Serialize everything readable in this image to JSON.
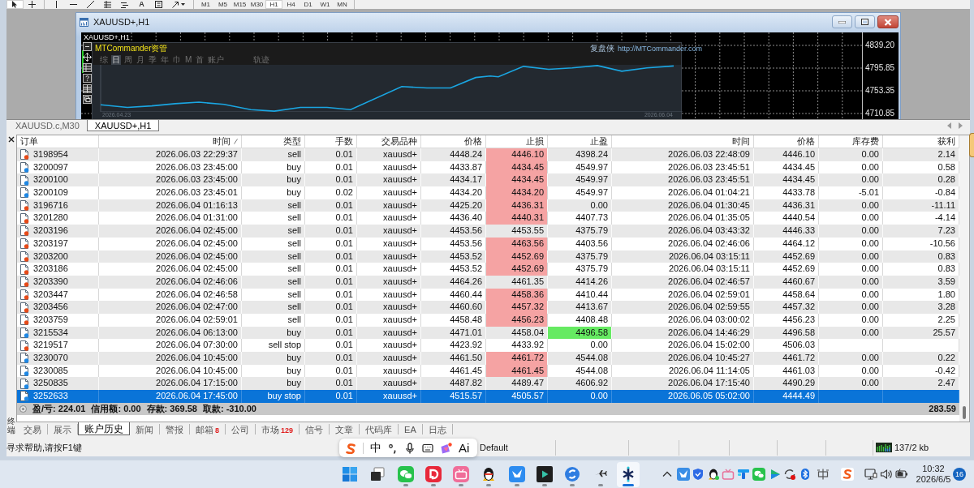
{
  "toolbar": {
    "tools": [
      {
        "kind": "cursor",
        "selected": true
      },
      {
        "kind": "crosshair",
        "selected": false
      },
      {
        "kind": "vertical-line",
        "selected": false
      },
      {
        "kind": "horizontal-line",
        "selected": false
      },
      {
        "kind": "trendline",
        "selected": false
      },
      {
        "kind": "fibonacci",
        "selected": false
      },
      {
        "kind": "channel",
        "selected": false
      },
      {
        "kind": "text",
        "label": "A",
        "selected": false
      },
      {
        "kind": "text-label",
        "selected": false
      },
      {
        "kind": "arrows",
        "selected": false
      }
    ],
    "timeframes": [
      {
        "label": "M1",
        "selected": false
      },
      {
        "label": "M5",
        "selected": false
      },
      {
        "label": "M15",
        "selected": false
      },
      {
        "label": "M30",
        "selected": false
      },
      {
        "label": "H1",
        "selected": true
      },
      {
        "label": "H4",
        "selected": false
      },
      {
        "label": "D1",
        "selected": false
      },
      {
        "label": "W1",
        "selected": false
      },
      {
        "label": "MN",
        "selected": false
      }
    ]
  },
  "chart_window": {
    "title": "XAUUSD+,H1",
    "chart_label": "XAUUSD+,H1",
    "price_labels": [
      "4839.20",
      "4795.85",
      "4753.35",
      "4710.85"
    ],
    "panel": {
      "title": "MTCommander资管",
      "brand": "复盘侠",
      "url": "http://MTCommander.com",
      "periods": [
        {
          "label": "综",
          "selected": false
        },
        {
          "label": "日",
          "selected": true
        },
        {
          "label": "周",
          "selected": false
        },
        {
          "label": "月",
          "selected": false
        },
        {
          "label": "季",
          "selected": false
        },
        {
          "label": "年",
          "selected": false
        },
        {
          "label": "巾",
          "selected": false
        },
        {
          "label": "M",
          "selected": false
        },
        {
          "label": "首",
          "selected": false
        },
        {
          "label": "账户",
          "selected": false
        },
        {
          "label": "轨迹",
          "selected": false
        }
      ],
      "dates": [
        "2026.04.23",
        "2026.06.04"
      ]
    }
  },
  "chart_tabs": [
    {
      "label": "XAUUSD.c,M30",
      "selected": false
    },
    {
      "label": "XAUUSD+,H1",
      "selected": true
    }
  ],
  "terminal": {
    "side_label": "终端",
    "columns": [
      {
        "label": "订单",
        "sorted": false
      },
      {
        "label": "时间",
        "sorted": true
      },
      {
        "label": "类型",
        "sorted": false
      },
      {
        "label": "手数",
        "sorted": false
      },
      {
        "label": "交易品种",
        "sorted": false
      },
      {
        "label": "价格",
        "sorted": false
      },
      {
        "label": "止损",
        "sorted": false
      },
      {
        "label": "止盈",
        "sorted": false
      },
      {
        "label": "时间",
        "sorted": false
      },
      {
        "label": "价格",
        "sorted": false
      },
      {
        "label": "库存费",
        "sorted": false
      },
      {
        "label": "获利",
        "sorted": false
      }
    ],
    "rows": [
      {
        "kind": "sell",
        "cells": [
          "3198954",
          "2026.06.03 22:29:37",
          "sell",
          "0.01",
          "xauusd+",
          "4448.24",
          "4446.10",
          "4398.24",
          "2026.06.03 22:48:09",
          "4446.10",
          "0.00",
          "2.14"
        ],
        "sl_hit": true,
        "tp_hit": false,
        "selected": false
      },
      {
        "kind": "buy",
        "cells": [
          "3200097",
          "2026.06.03 23:45:00",
          "buy",
          "0.01",
          "xauusd+",
          "4433.87",
          "4434.45",
          "4549.97",
          "2026.06.03 23:45:51",
          "4434.45",
          "0.00",
          "0.58"
        ],
        "sl_hit": true,
        "tp_hit": false,
        "selected": false
      },
      {
        "kind": "buy",
        "cells": [
          "3200100",
          "2026.06.03 23:45:00",
          "buy",
          "0.01",
          "xauusd+",
          "4434.17",
          "4434.45",
          "4549.97",
          "2026.06.03 23:45:51",
          "4434.45",
          "0.00",
          "0.28"
        ],
        "sl_hit": true,
        "tp_hit": false,
        "selected": false
      },
      {
        "kind": "buy",
        "cells": [
          "3200109",
          "2026.06.03 23:45:01",
          "buy",
          "0.02",
          "xauusd+",
          "4434.20",
          "4434.20",
          "4549.97",
          "2026.06.04 01:04:21",
          "4433.78",
          "-5.01",
          "-0.84"
        ],
        "sl_hit": true,
        "tp_hit": false,
        "selected": false
      },
      {
        "kind": "sell",
        "cells": [
          "3196716",
          "2026.06.04 01:16:13",
          "sell",
          "0.01",
          "xauusd+",
          "4425.20",
          "4436.31",
          "0.00",
          "2026.06.04 01:30:45",
          "4436.31",
          "0.00",
          "-11.11"
        ],
        "sl_hit": true,
        "tp_hit": false,
        "selected": false
      },
      {
        "kind": "sell",
        "cells": [
          "3201280",
          "2026.06.04 01:31:00",
          "sell",
          "0.01",
          "xauusd+",
          "4436.40",
          "4440.31",
          "4407.73",
          "2026.06.04 01:35:05",
          "4440.54",
          "0.00",
          "-4.14"
        ],
        "sl_hit": true,
        "tp_hit": false,
        "selected": false
      },
      {
        "kind": "sell",
        "cells": [
          "3203196",
          "2026.06.04 02:45:00",
          "sell",
          "0.01",
          "xauusd+",
          "4453.56",
          "4453.55",
          "4375.79",
          "2026.06.04 03:43:32",
          "4446.33",
          "0.00",
          "7.23"
        ],
        "sl_hit": false,
        "tp_hit": false,
        "selected": false
      },
      {
        "kind": "sell",
        "cells": [
          "3203197",
          "2026.06.04 02:45:00",
          "sell",
          "0.01",
          "xauusd+",
          "4453.56",
          "4463.56",
          "4403.56",
          "2026.06.04 02:46:06",
          "4464.12",
          "0.00",
          "-10.56"
        ],
        "sl_hit": true,
        "tp_hit": false,
        "selected": false
      },
      {
        "kind": "sell",
        "cells": [
          "3203200",
          "2026.06.04 02:45:00",
          "sell",
          "0.01",
          "xauusd+",
          "4453.52",
          "4452.69",
          "4375.79",
          "2026.06.04 03:15:11",
          "4452.69",
          "0.00",
          "0.83"
        ],
        "sl_hit": true,
        "tp_hit": false,
        "selected": false
      },
      {
        "kind": "sell",
        "cells": [
          "3203186",
          "2026.06.04 02:45:00",
          "sell",
          "0.01",
          "xauusd+",
          "4453.52",
          "4452.69",
          "4375.79",
          "2026.06.04 03:15:11",
          "4452.69",
          "0.00",
          "0.83"
        ],
        "sl_hit": true,
        "tp_hit": false,
        "selected": false
      },
      {
        "kind": "sell",
        "cells": [
          "3203390",
          "2026.06.04 02:46:06",
          "sell",
          "0.01",
          "xauusd+",
          "4464.26",
          "4461.35",
          "4414.26",
          "2026.06.04 02:46:57",
          "4460.67",
          "0.00",
          "3.59"
        ],
        "sl_hit": false,
        "tp_hit": false,
        "selected": false
      },
      {
        "kind": "sell",
        "cells": [
          "3203447",
          "2026.06.04 02:46:58",
          "sell",
          "0.01",
          "xauusd+",
          "4460.44",
          "4458.36",
          "4410.44",
          "2026.06.04 02:59:01",
          "4458.64",
          "0.00",
          "1.80"
        ],
        "sl_hit": true,
        "tp_hit": false,
        "selected": false
      },
      {
        "kind": "sell",
        "cells": [
          "3203456",
          "2026.06.04 02:47:00",
          "sell",
          "0.01",
          "xauusd+",
          "4460.60",
          "4457.32",
          "4413.67",
          "2026.06.04 02:59:55",
          "4457.32",
          "0.00",
          "3.28"
        ],
        "sl_hit": true,
        "tp_hit": false,
        "selected": false
      },
      {
        "kind": "sell",
        "cells": [
          "3203759",
          "2026.06.04 02:59:01",
          "sell",
          "0.01",
          "xauusd+",
          "4458.48",
          "4456.23",
          "4408.48",
          "2026.06.04 03:00:02",
          "4456.23",
          "0.00",
          "2.25"
        ],
        "sl_hit": true,
        "tp_hit": false,
        "selected": false
      },
      {
        "kind": "buy",
        "cells": [
          "3215534",
          "2026.06.04 06:13:00",
          "buy",
          "0.01",
          "xauusd+",
          "4471.01",
          "4458.04",
          "4496.58",
          "2026.06.04 14:46:29",
          "4496.58",
          "0.00",
          "25.57"
        ],
        "sl_hit": false,
        "tp_hit": true,
        "selected": false
      },
      {
        "kind": "sell",
        "cells": [
          "3219517",
          "2026.06.04 07:30:00",
          "sell stop",
          "0.01",
          "xauusd+",
          "4423.92",
          "4433.92",
          "0.00",
          "2026.06.04 15:02:00",
          "4506.03"
        ],
        "sl_hit": false,
        "tp_hit": false,
        "selected": false
      },
      {
        "kind": "buy",
        "cells": [
          "3230070",
          "2026.06.04 10:45:00",
          "buy",
          "0.01",
          "xauusd+",
          "4461.50",
          "4461.72",
          "4544.08",
          "2026.06.04 10:45:27",
          "4461.72",
          "0.00",
          "0.22"
        ],
        "sl_hit": true,
        "tp_hit": false,
        "selected": false
      },
      {
        "kind": "buy",
        "cells": [
          "3230085",
          "2026.06.04 10:45:00",
          "buy",
          "0.01",
          "xauusd+",
          "4461.45",
          "4461.45",
          "4544.08",
          "2026.06.04 11:14:05",
          "4461.03",
          "0.00",
          "-0.42"
        ],
        "sl_hit": true,
        "tp_hit": false,
        "selected": false
      },
      {
        "kind": "buy",
        "cells": [
          "3250835",
          "2026.06.04 17:15:00",
          "buy",
          "0.01",
          "xauusd+",
          "4487.82",
          "4489.47",
          "4606.92",
          "2026.06.04 17:15:40",
          "4490.29",
          "0.00",
          "2.47"
        ],
        "sl_hit": false,
        "tp_hit": false,
        "selected": false
      },
      {
        "kind": "buy",
        "cells": [
          "3252633",
          "2026.06.04 17:45:00",
          "buy stop",
          "0.01",
          "xauusd+",
          "4515.57",
          "4505.57",
          "0.00",
          "2026.06.05 05:02:00",
          "4444.49"
        ],
        "sl_hit": false,
        "tp_hit": false,
        "selected": true
      }
    ],
    "summary": {
      "items": [
        "盈/亏: 224.01",
        "信用额: 0.00",
        "存款: 369.58",
        "取款: -310.00"
      ],
      "total": "283.59"
    },
    "tabs": [
      {
        "label": "交易",
        "selected": false
      },
      {
        "label": "展示",
        "selected": false
      },
      {
        "label": "账户历史",
        "selected": true
      },
      {
        "label": "新闻",
        "selected": false
      },
      {
        "label": "警报",
        "selected": false
      },
      {
        "label": "邮箱",
        "badge": "8",
        "selected": false
      },
      {
        "label": "公司",
        "selected": false
      },
      {
        "label": "市场",
        "badge": "129",
        "selected": false
      },
      {
        "label": "信号",
        "selected": false
      },
      {
        "label": "文章",
        "selected": false
      },
      {
        "label": "代码库",
        "selected": false
      },
      {
        "label": "EA",
        "selected": false
      },
      {
        "label": "日志",
        "selected": false
      }
    ]
  },
  "status_bar": {
    "help": "寻求帮助,请按F1键",
    "profile": "Default",
    "traffic": "137/2 kb"
  },
  "ime_bar": {
    "mode": "中",
    "assistant": "Ai"
  },
  "taskbar": {
    "apps": [
      {
        "kind": "start",
        "running": false,
        "selected": false
      },
      {
        "kind": "task-view",
        "running": false,
        "selected": false
      },
      {
        "kind": "chat",
        "running": true,
        "selected": false
      },
      {
        "kind": "reader",
        "running": true,
        "selected": false
      },
      {
        "kind": "tv",
        "running": true,
        "selected": false
      },
      {
        "kind": "penguin",
        "running": true,
        "selected": false
      },
      {
        "kind": "bird",
        "running": true,
        "selected": false
      },
      {
        "kind": "player",
        "running": true,
        "selected": false
      },
      {
        "kind": "circle",
        "running": true,
        "selected": false
      },
      {
        "kind": "plane",
        "running": true,
        "selected": false
      },
      {
        "kind": "asterisk",
        "running": true,
        "selected": true
      }
    ],
    "time": "10:32",
    "date": "2026/6/5",
    "notifications": "16"
  }
}
